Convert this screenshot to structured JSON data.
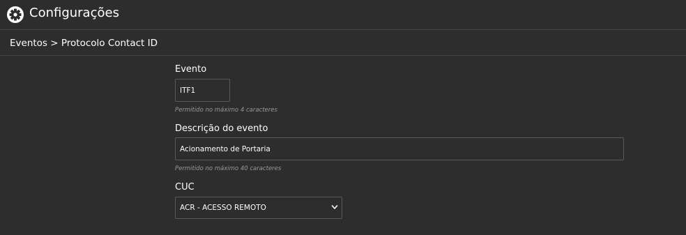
{
  "header": {
    "title": "Configurações",
    "icon": "gear-icon"
  },
  "breadcrumb": {
    "text": "Eventos > Protocolo Contact ID"
  },
  "form": {
    "evento": {
      "label": "Evento",
      "value": "ITF1",
      "help": "Permitido no máximo 4 caracteres"
    },
    "descricao": {
      "label": "Descrição do evento",
      "value": "Acionamento de Portaria",
      "help": "Permitido no máximo 40 caracteres"
    },
    "cuc": {
      "label": "CUC",
      "selected": "ACR - ACESSO REMOTO",
      "icon": "chevron-down-icon"
    }
  },
  "colors": {
    "background": "#2d2d2d",
    "border": "#5a5a5a",
    "divider": "#444444",
    "help_text": "#9a9a9a"
  }
}
